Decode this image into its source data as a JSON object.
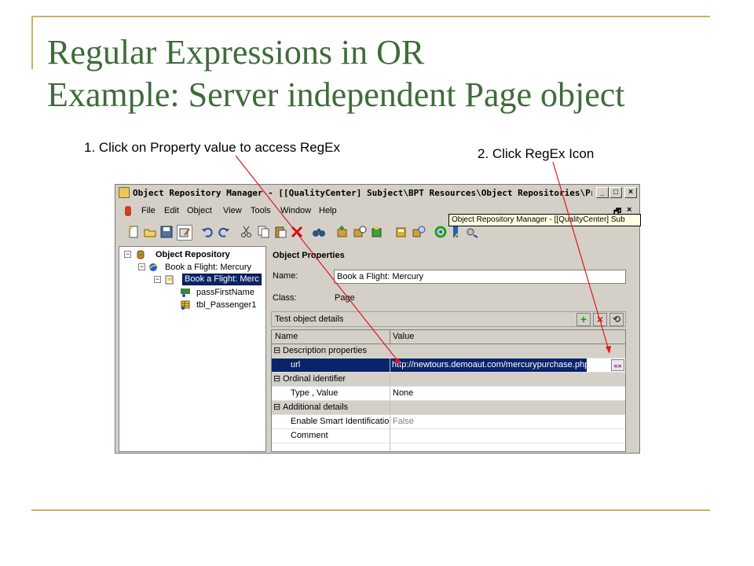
{
  "slide": {
    "title_line1": "Regular Expressions in OR",
    "title_line2": "Example: Server independent Page object",
    "callout1": "1. Click on Property value to access RegEx",
    "callout2": "2. Click RegEx Icon"
  },
  "window": {
    "title": "Object Repository Manager - [[QualityCenter] Subject\\BPT Resources\\Object Repositories\\Presentati...",
    "controls": {
      "minimize": "_",
      "restore": "□",
      "close": "×"
    },
    "menu": [
      "File",
      "Edit",
      "Object",
      "View",
      "Tools",
      "Window",
      "Help"
    ],
    "mdi_controls": {
      "restore": "🗗",
      "close": "×"
    },
    "tooltip": "Object Repository Manager - [[QualityCenter] Sub"
  },
  "tree": {
    "items": [
      {
        "label": "Object Repository"
      },
      {
        "label": "Book a Flight: Mercury"
      },
      {
        "label": "Book a Flight: Merc"
      },
      {
        "label": "passFirstName"
      },
      {
        "label": "tbl_Passenger1"
      }
    ]
  },
  "properties": {
    "header": "Object Properties",
    "name_label": "Name:",
    "name_value": "Book a Flight: Mercury",
    "class_label": "Class:",
    "class_value": "Page",
    "test_object_details": "Test object details",
    "buttons": {
      "add": "+",
      "remove": "×",
      "reset": "⟲"
    },
    "grid": {
      "col_name": "Name",
      "col_value": "Value",
      "rows": [
        {
          "type": "section",
          "name": "Description properties"
        },
        {
          "type": "prop",
          "name": "url",
          "value": "http://newtours.demoaut.com/mercurypurchase.php",
          "selected": true
        },
        {
          "type": "section",
          "name": "Ordinal identifier"
        },
        {
          "type": "prop",
          "name": "Type , Value",
          "value": "None"
        },
        {
          "type": "section",
          "name": "Additional details"
        },
        {
          "type": "prop",
          "name": "Enable Smart Identification",
          "value": "False"
        },
        {
          "type": "prop",
          "name": "Comment",
          "value": ""
        }
      ],
      "regex_icon_label": "«»"
    }
  },
  "colors": {
    "title_green": "#3f6c3a",
    "rule_gold": "#c8b45a",
    "select_blue": "#0a246a",
    "arrow_red": "#e0141e"
  }
}
